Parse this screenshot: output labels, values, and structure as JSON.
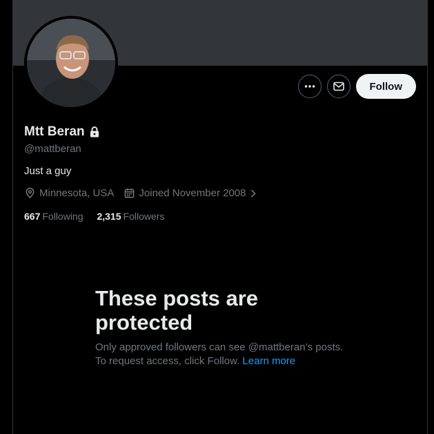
{
  "profile": {
    "name": "Mtt Beran",
    "handle": "@mattberan",
    "bio": "Just a guy",
    "location": "Minnesota, USA",
    "joined": "Joined November 2008",
    "following_count": "667",
    "following_label": "Following",
    "followers_count": "2,315",
    "followers_label": "Followers"
  },
  "actions": {
    "follow_label": "Follow",
    "more_icon": "more-icon",
    "message_icon": "envelope-icon"
  },
  "protected": {
    "title": "These posts are protected",
    "text": "Only approved followers can see @mattberan’s posts. To request access, click Follow. ",
    "link": "Learn more"
  },
  "colors": {
    "background": "#000000",
    "banner": "#333639",
    "accent": "#1d9bf0",
    "secondary_text": "#71767b",
    "follow_button": "#eff3f4"
  }
}
